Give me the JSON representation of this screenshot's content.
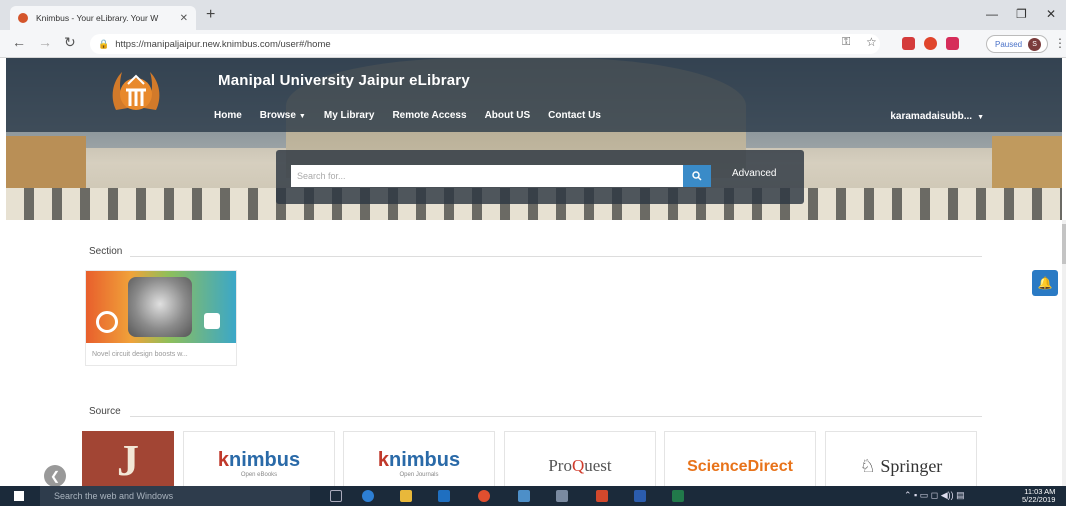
{
  "browser": {
    "tab_title": "Knimbus - Your eLibrary. Your W",
    "url": "https://manipaljaipur.new.knimbus.com/user#/home",
    "profile_status": "Paused",
    "profile_initial": "S"
  },
  "header": {
    "site_title": "Manipal University Jaipur eLibrary",
    "menu": [
      {
        "label": "Home"
      },
      {
        "label": "Browse"
      },
      {
        "label": "My Library"
      },
      {
        "label": "Remote Access"
      },
      {
        "label": "About US"
      },
      {
        "label": "Contact Us"
      }
    ],
    "user_name": "karamadaisubb..."
  },
  "search": {
    "placeholder": "Search for...",
    "advanced_label": "Advanced"
  },
  "sections": {
    "section_heading": "Section",
    "section_card_caption": "Novel circuit design boosts w...",
    "source_heading": "Source"
  },
  "sources": [
    {
      "name": "jstor-logo",
      "letter": "J"
    },
    {
      "name": "knimbus-ebooks",
      "brand": "nimbus",
      "brand_k": "k",
      "sub": "Open eBooks"
    },
    {
      "name": "knimbus-journals",
      "brand": "nimbus",
      "brand_k": "k",
      "sub": "Open Journals"
    },
    {
      "name": "proquest",
      "pre": "Pro",
      "o": "Q",
      "post": "uest"
    },
    {
      "name": "sciencedirect",
      "label": "ScienceDirect"
    },
    {
      "name": "springer",
      "label": "Springer"
    }
  ],
  "taskbar": {
    "search_placeholder": "Search the web and Windows",
    "time": "11:03 AM",
    "date": "5/22/2019"
  },
  "colors": {
    "accent": "#3a8bc8",
    "navbar": "#283746",
    "bell": "#2a7ac4"
  }
}
